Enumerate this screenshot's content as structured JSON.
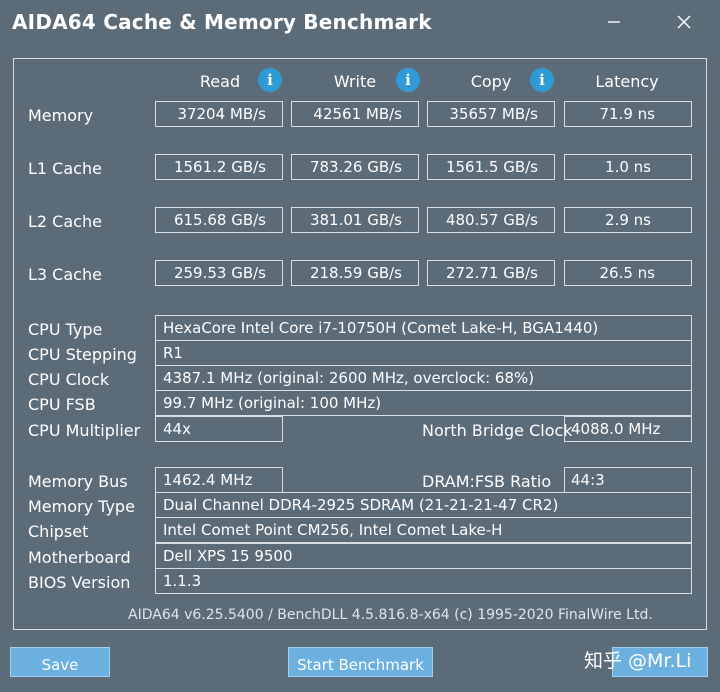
{
  "window": {
    "title": "AIDA64 Cache & Memory Benchmark"
  },
  "columns": {
    "read": "Read",
    "write": "Write",
    "copy": "Copy",
    "latency": "Latency"
  },
  "benchmarks": [
    {
      "label": "Memory",
      "read": "37204 MB/s",
      "write": "42561 MB/s",
      "copy": "35657 MB/s",
      "latency": "71.9 ns"
    },
    {
      "label": "L1 Cache",
      "read": "1561.2 GB/s",
      "write": "783.26 GB/s",
      "copy": "1561.5 GB/s",
      "latency": "1.0 ns"
    },
    {
      "label": "L2 Cache",
      "read": "615.68 GB/s",
      "write": "381.01 GB/s",
      "copy": "480.57 GB/s",
      "latency": "2.9 ns"
    },
    {
      "label": "L3 Cache",
      "read": "259.53 GB/s",
      "write": "218.59 GB/s",
      "copy": "272.71 GB/s",
      "latency": "26.5 ns"
    }
  ],
  "cpu": {
    "type_label": "CPU Type",
    "type": "HexaCore Intel Core i7-10750H  (Comet Lake-H, BGA1440)",
    "stepping_label": "CPU Stepping",
    "stepping": "R1",
    "clock_label": "CPU Clock",
    "clock": "4387.1 MHz  (original: 2600 MHz, overclock: 68%)",
    "fsb_label": "CPU FSB",
    "fsb": "99.7 MHz  (original: 100 MHz)",
    "multiplier_label": "CPU Multiplier",
    "multiplier": "44x",
    "nb_clock_label": "North Bridge Clock",
    "nb_clock": "4088.0 MHz"
  },
  "memory": {
    "bus_label": "Memory Bus",
    "bus": "1462.4 MHz",
    "ratio_label": "DRAM:FSB Ratio",
    "ratio": "44:3",
    "type_label": "Memory Type",
    "type": "Dual Channel DDR4-2925 SDRAM  (21-21-21-47 CR2)",
    "chipset_label": "Chipset",
    "chipset": "Intel Comet Point CM256, Intel Comet Lake-H",
    "motherboard_label": "Motherboard",
    "motherboard": "Dell XPS 15 9500",
    "bios_label": "BIOS Version",
    "bios": "1.1.3"
  },
  "footer": {
    "text": "AIDA64 v6.25.5400 / BenchDLL 4.5.816.8-x64  (c) 1995-2020 FinalWire Ltd."
  },
  "buttons": {
    "save": "Save",
    "start": "Start Benchmark"
  },
  "watermark": "知乎 @Mr.Li",
  "colors": {
    "background": "#5b6b78",
    "border": "#d8dde2",
    "info": "#2f9ad6",
    "button": "#6cb0e0"
  }
}
